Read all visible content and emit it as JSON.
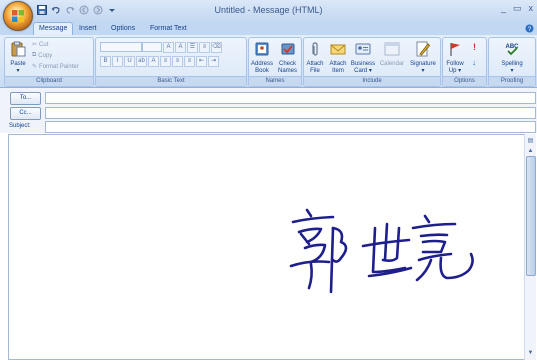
{
  "window": {
    "title": "Untitled - Message (HTML)",
    "controls": [
      "_",
      "▭",
      "x"
    ]
  },
  "quick_access": [
    "save-icon",
    "undo-icon",
    "redo-icon",
    "previous-icon",
    "next-icon",
    "customize-icon"
  ],
  "tabs": [
    {
      "label": "Message",
      "active": true
    },
    {
      "label": "Insert",
      "active": false
    },
    {
      "label": "Options",
      "active": false
    },
    {
      "label": "Format Text",
      "active": false
    }
  ],
  "ribbon": {
    "clipboard": {
      "label": "Clipboard",
      "paste": "Paste",
      "cut": "Cut",
      "copy": "Copy",
      "format_painter": "Format Painter"
    },
    "basic_text": {
      "label": "Basic Text"
    },
    "names": {
      "label": "Names",
      "address_book": "Address Book",
      "check_names": "Check Names"
    },
    "include": {
      "label": "Include",
      "attach_file": "Attach File",
      "attach_item": "Attach Item",
      "business_card": "Business Card",
      "calendar": "Calendar",
      "signature": "Signature"
    },
    "options": {
      "label": "Options",
      "follow_up": "Follow Up"
    },
    "proofing": {
      "label": "Proofing",
      "spelling": "Spelling"
    }
  },
  "header": {
    "to_button": "To...",
    "cc_button": "Cc...",
    "subject_label": "Subject:"
  },
  "colors": {
    "ribbon_bg": "#d6e5f7",
    "accent": "#15428b",
    "signature_ink": "#1e1e8c"
  }
}
